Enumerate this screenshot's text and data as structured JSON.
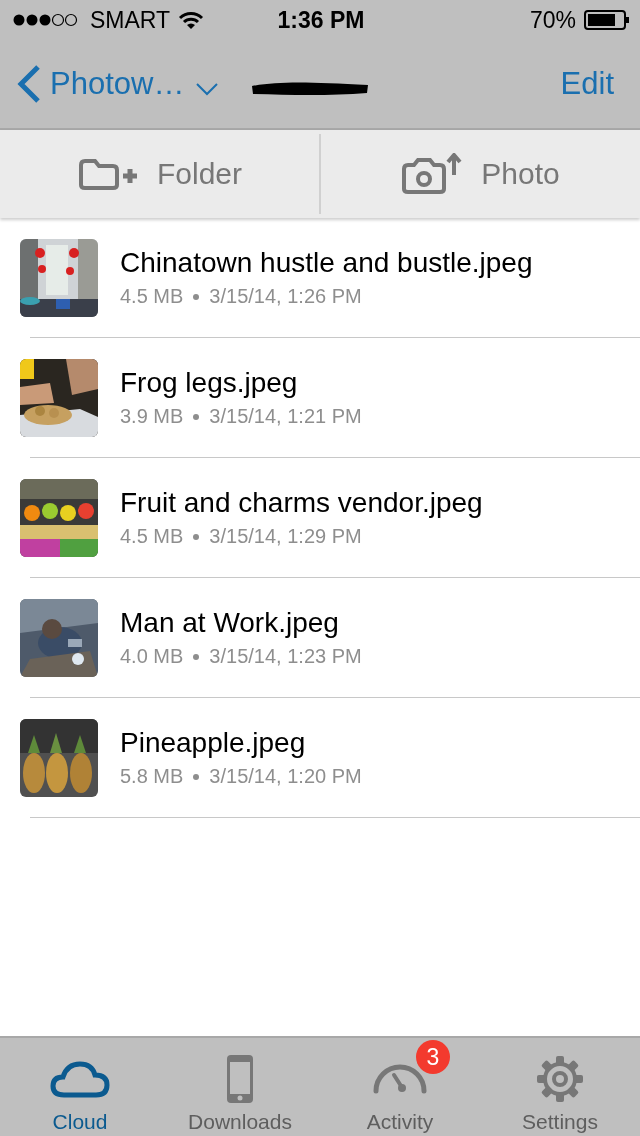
{
  "status_bar": {
    "carrier": "SMART",
    "time": "1:36 PM",
    "battery": "70%"
  },
  "nav": {
    "back": "Photow…",
    "edit": "Edit"
  },
  "toolbar": [
    {
      "kind": "folder",
      "label": "Folder"
    },
    {
      "label": "Photo"
    }
  ],
  "files": [
    {
      "name": "Chinatown hustle and bustle.jpeg",
      "size": "4.5 MB",
      "date": "3/15/14, 1:26 PM"
    },
    {
      "name": "Frog legs.jpeg",
      "size": "3.9 MB",
      "date": "3/15/14, 1:21 PM"
    },
    {
      "name": "Fruit and charms vendor.jpeg",
      "size": "4.5 MB",
      "date": "3/15/14, 1:29 PM"
    },
    {
      "name": "Man at Work.jpeg",
      "size": "4.0 MB",
      "date": "3/15/14, 1:23 PM"
    },
    {
      "name": "Pineapple.jpeg",
      "size": "5.8 MB",
      "date": "3/15/14, 1:20 PM"
    }
  ],
  "tabs": [
    {
      "kind": "cloud",
      "label": "Cloud",
      "selected": true
    },
    {
      "kind": "phone",
      "label": "Downloads",
      "selected": false
    },
    {
      "kind": "gauge",
      "label": "Activity",
      "selected": false,
      "badge": "3"
    },
    {
      "kind": "gear",
      "label": "Settings",
      "selected": false
    }
  ]
}
